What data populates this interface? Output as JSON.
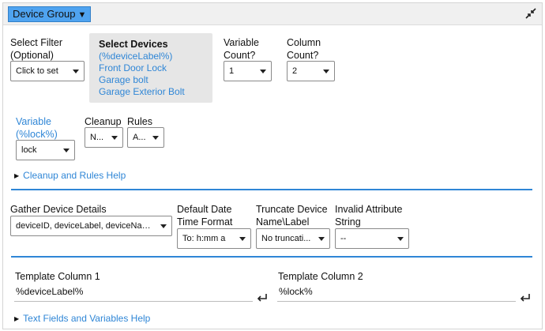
{
  "header": {
    "group_button": "Device Group",
    "dropdown_glyph": "▼"
  },
  "filter": {
    "label_line1": "Select Filter",
    "label_line2": "(Optional)",
    "value": "Click to set"
  },
  "devices": {
    "title": "Select Devices",
    "items": [
      "(%deviceLabel%)",
      "Front Door Lock",
      "Garage bolt",
      "Garage Exterior Bolt"
    ]
  },
  "variable_count": {
    "label_line1": "Variable",
    "label_line2": "Count?",
    "value": "1"
  },
  "column_count": {
    "label_line1": "Column",
    "label_line2": "Count?",
    "value": "2"
  },
  "variable": {
    "label_line1": "Variable",
    "label_line2": "(%lock%)",
    "value": "lock"
  },
  "cleanup": {
    "label": "Cleanup",
    "value": "N..."
  },
  "rules": {
    "label": "Rules",
    "value": "A..."
  },
  "help_cleanup": "Cleanup and Rules Help",
  "gather": {
    "label": "Gather Device Details",
    "value": "deviceID, deviceLabel, deviceName, la..."
  },
  "date_format": {
    "label_line1": "Default Date",
    "label_line2": "Time Format",
    "value": "To: h:mm a"
  },
  "truncate": {
    "label_line1": "Truncate Device",
    "label_line2": "Name\\Label",
    "value": "No truncati..."
  },
  "invalid_attr": {
    "label_line1": "Invalid Attribute",
    "label_line2": "String",
    "value": "--"
  },
  "template1": {
    "label": "Template Column 1",
    "value": "%deviceLabel%"
  },
  "template2": {
    "label": "Template Column 2",
    "value": "%lock%"
  },
  "help_text_fields": "Text Fields and Variables Help",
  "colors": {
    "accent": "#2f86d6",
    "header_button": "#4fa3f0",
    "device_box": "#e6e6e6"
  },
  "icons": {
    "collapse": "collapse-arrows-icon",
    "enter": "enter-return-icon",
    "disclosure": "disclosure-triangle-icon"
  }
}
